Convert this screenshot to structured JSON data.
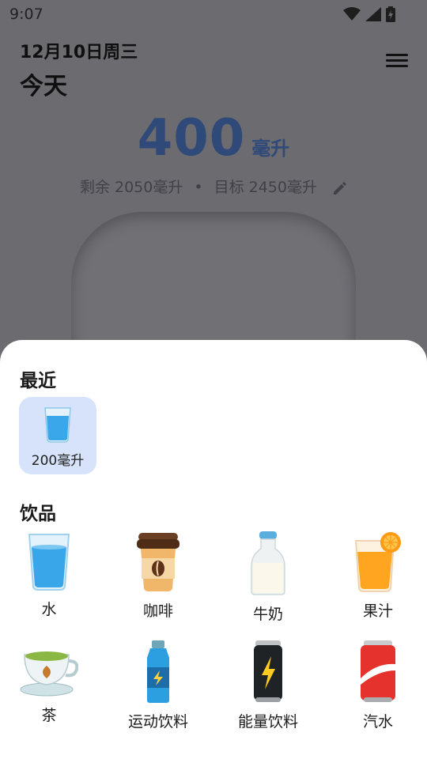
{
  "status_bar": {
    "time": "9:07"
  },
  "header": {
    "date": "12月10日周三",
    "title": "今天"
  },
  "intake": {
    "amount": "400",
    "unit": "毫升",
    "remaining": "剩余 2050毫升",
    "separator": "•",
    "goal": "目标 2450毫升"
  },
  "sheet": {
    "recent_title": "最近",
    "recent_items": [
      {
        "label": "200毫升",
        "icon": "water-glass-icon"
      }
    ],
    "drinks_title": "饮品",
    "drinks": [
      {
        "label": "水",
        "icon": "water-glass-icon"
      },
      {
        "label": "咖啡",
        "icon": "coffee-cup-icon"
      },
      {
        "label": "牛奶",
        "icon": "milk-bottle-icon"
      },
      {
        "label": "果汁",
        "icon": "juice-glass-icon"
      },
      {
        "label": "茶",
        "icon": "tea-cup-icon"
      },
      {
        "label": "运动饮料",
        "icon": "sports-drink-icon"
      },
      {
        "label": "能量饮料",
        "icon": "energy-drink-icon"
      },
      {
        "label": "汽水",
        "icon": "soda-can-icon"
      }
    ]
  },
  "colors": {
    "accent": "#2f4a78",
    "chip_bg": "#d6e3fa",
    "scrim": "#6c6b70"
  }
}
